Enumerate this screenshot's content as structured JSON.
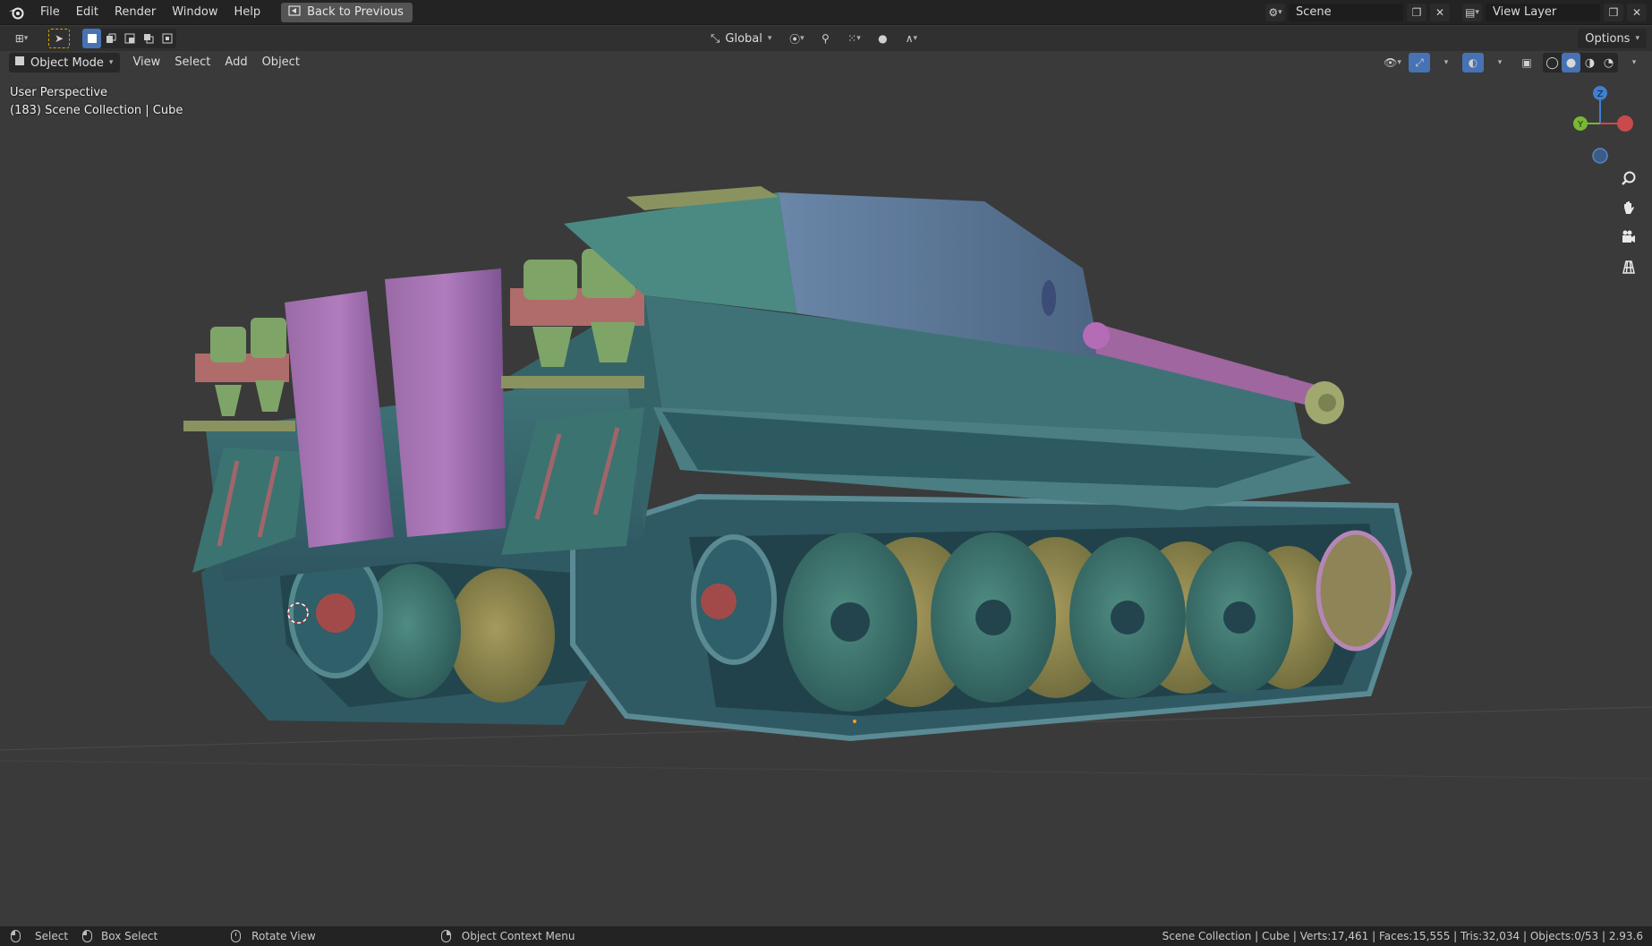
{
  "menubar": {
    "items": [
      "File",
      "Edit",
      "Render",
      "Window",
      "Help"
    ],
    "back_button": "Back to Previous",
    "scene": "Scene",
    "view_layer": "View Layer"
  },
  "toolheader": {
    "orientation": "Global",
    "options": "Options"
  },
  "viewport_header": {
    "mode": "Object Mode",
    "menus": [
      "View",
      "Select",
      "Add",
      "Object"
    ]
  },
  "overlay": {
    "perspective": "User Perspective",
    "collection": "(183) Scene Collection | Cube"
  },
  "gizmo": {
    "z": "Z",
    "y": "Y",
    "colors": {
      "x": "#c94a4a",
      "y": "#78b834",
      "z": "#3f7fd0"
    }
  },
  "statusbar": {
    "select": "Select",
    "box_select": "Box Select",
    "rotate_view": "Rotate View",
    "context_menu": "Object Context Menu",
    "stats": "Scene Collection | Cube | Verts:17,461 | Faces:15,555 | Tris:32,034 | Objects:0/53 | 2.93.6"
  },
  "icons": [
    "blender-logo-icon",
    "back-icon",
    "select-tool-icon",
    "orientation-icon",
    "pivot-icon",
    "snap-icon",
    "proportional-icon",
    "visibility-icon",
    "gizmo-icon",
    "overlay-icon",
    "xray-icon",
    "wireframe-shading-icon",
    "solid-shading-icon",
    "material-shading-icon",
    "rendered-shading-icon",
    "zoom-icon",
    "hand-icon",
    "camera-icon",
    "grid-icon"
  ],
  "theme": {
    "accent": "#4772b3",
    "background": "#3a3a3a",
    "header": "#232323"
  }
}
